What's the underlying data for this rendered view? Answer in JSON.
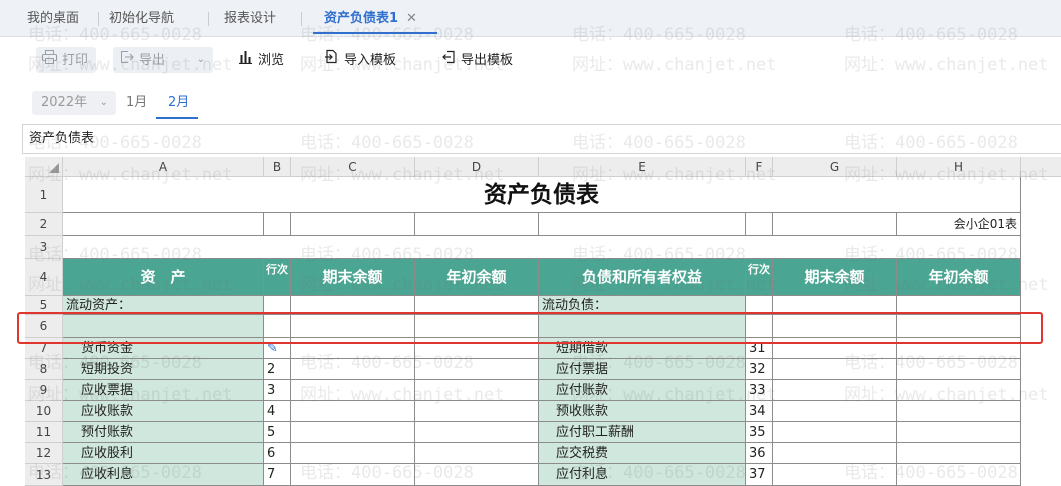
{
  "tabs": [
    {
      "label": "我的桌面"
    },
    {
      "label": "初始化导航"
    },
    {
      "label": "报表设计"
    },
    {
      "label": "资产负债表1",
      "active": true,
      "closable": true
    }
  ],
  "toolbar": [
    {
      "label": "打印",
      "icon": "printer-icon",
      "disabled": true
    },
    {
      "label": "导出",
      "icon": "export-icon",
      "disabled": true,
      "dropdown": true
    },
    {
      "label": "浏览",
      "icon": "bar-chart-icon"
    },
    {
      "label": "导入模板",
      "icon": "import-icon"
    },
    {
      "label": "导出模板",
      "icon": "export-template-icon"
    }
  ],
  "period": {
    "year": "2022年",
    "months": [
      "1月",
      "2月"
    ],
    "active_month": "2月"
  },
  "sheet_name": "资产负债表",
  "columns": [
    "A",
    "B",
    "C",
    "D",
    "E",
    "F",
    "G",
    "H"
  ],
  "rows": [
    "1",
    "2",
    "3",
    "4",
    "5",
    "6",
    "7",
    "8",
    "9",
    "10",
    "11",
    "12",
    "13"
  ],
  "report": {
    "title": "资产负债表",
    "form_code": "会小企01表",
    "headers": {
      "asset": "资　产",
      "line_no": "行次",
      "ending": "期末余额",
      "opening": "年初余额",
      "liabilities": "负债和所有者权益"
    },
    "section_left": "流动资产：",
    "section_right": "流动负债：",
    "left_items": [
      {
        "name": "货币资金",
        "line": ""
      },
      {
        "name": "短期投资",
        "line": "2"
      },
      {
        "name": "应收票据",
        "line": "3"
      },
      {
        "name": "应收账款",
        "line": "4"
      },
      {
        "name": "预付账款",
        "line": "5"
      },
      {
        "name": "应收股利",
        "line": "6"
      },
      {
        "name": "应收利息",
        "line": "7"
      }
    ],
    "right_items": [
      {
        "name": "短期借款",
        "line": "31"
      },
      {
        "name": "应付票据",
        "line": "32"
      },
      {
        "name": "应付账款",
        "line": "33"
      },
      {
        "name": "预收账款",
        "line": "34"
      },
      {
        "name": "应付职工薪酬",
        "line": "35"
      },
      {
        "name": "应交税费",
        "line": "36"
      },
      {
        "name": "应付利息",
        "line": "37"
      }
    ]
  },
  "watermark": {
    "phone": "电话：400-665-0028",
    "site": "网址：www.chanjet.net"
  },
  "colors": {
    "accent": "#2f6fd0",
    "header_green": "#4aa592",
    "cell_green": "#cfe7dc",
    "highlight": "#e0362d"
  }
}
